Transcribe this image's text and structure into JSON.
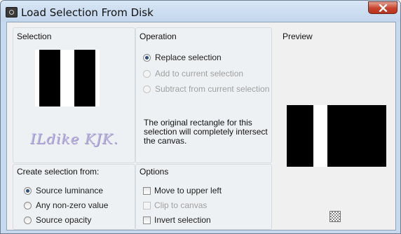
{
  "window": {
    "title": "Load Selection From Disk"
  },
  "selection": {
    "title": "Selection",
    "watermark": "ILdike KJK."
  },
  "operation": {
    "title": "Operation",
    "options": [
      {
        "label": "Replace selection",
        "selected": true,
        "enabled": true
      },
      {
        "label": "Add to current selection",
        "selected": false,
        "enabled": false
      },
      {
        "label": "Subtract from current selection",
        "selected": false,
        "enabled": false
      }
    ],
    "description": "The original rectangle for this selection will completely intersect the canvas."
  },
  "preview": {
    "title": "Preview"
  },
  "create_from": {
    "title": "Create selection from:",
    "options": [
      {
        "label": "Source luminance",
        "selected": true
      },
      {
        "label": "Any non-zero value",
        "selected": false
      },
      {
        "label": "Source opacity",
        "selected": false
      }
    ]
  },
  "options": {
    "title": "Options",
    "items": [
      {
        "label": "Move to upper left",
        "checked": false,
        "enabled": true
      },
      {
        "label": "Clip to canvas",
        "checked": false,
        "enabled": false
      },
      {
        "label": "Invert selection",
        "checked": false,
        "enabled": true
      }
    ]
  },
  "colors": {
    "title_bar": "#c6d9ee",
    "close_button": "#c7432c",
    "radio_dot": "#2c4f7a"
  },
  "icons": [
    "app-icon",
    "close-icon",
    "checkerboard-icon"
  ]
}
